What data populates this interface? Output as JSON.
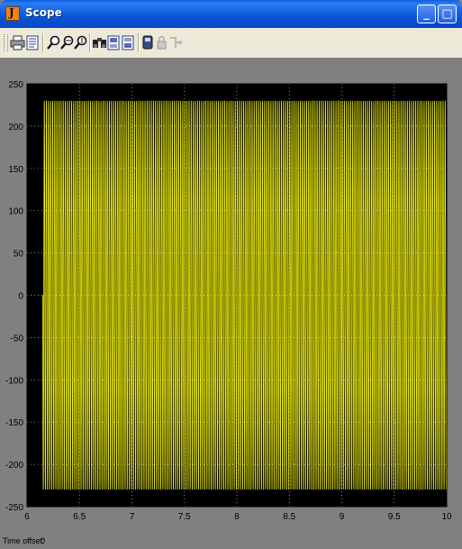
{
  "window": {
    "title": "Scope"
  },
  "toolbar": {
    "icons": [
      "print-icon",
      "parameters-icon",
      "zoom-icon",
      "zoom-x-icon",
      "zoom-y-icon",
      "autoscale-icon",
      "save-axes-icon",
      "restore-axes-icon",
      "floating-scope-icon",
      "lock-axes-icon",
      "signal-selection-icon"
    ]
  },
  "status": {
    "time_offset_label": "Time offset:",
    "time_offset_value": "0"
  },
  "colors": {
    "trace": "#f2f20c",
    "plot_bg": "#000000",
    "frame": "#808080",
    "grid": "#ffffff"
  },
  "chart_data": {
    "type": "line",
    "xlim": [
      6,
      10
    ],
    "ylim": [
      -250,
      250
    ],
    "xticks": [
      "6",
      "6.5",
      "7",
      "7.5",
      "8",
      "8.5",
      "9",
      "9.5",
      "10"
    ],
    "yticks": [
      "250",
      "200",
      "150",
      "100",
      "50",
      "0",
      "-50",
      "-100",
      "-150",
      "-200",
      "-250"
    ],
    "grid": true,
    "series": [
      {
        "function": "sine",
        "amplitude": 230,
        "frequency_hz": 50,
        "t_start": 6.15,
        "t_end": 10
      }
    ]
  }
}
